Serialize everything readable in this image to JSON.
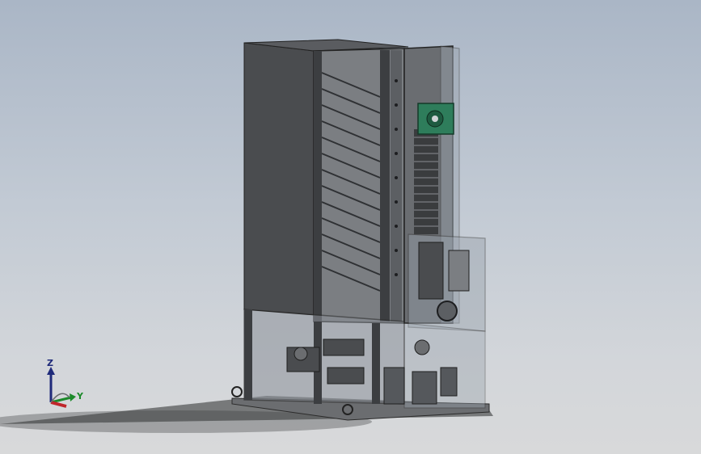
{
  "viewport": {
    "background_top": "#aab6c6",
    "background_bottom": "#d8d9da"
  },
  "model": {
    "frame_color": "#3a3a3a",
    "panel_color": "#4a4c4f",
    "motor_color": "#2e7d5b",
    "glass_color": "#9aa3ad"
  },
  "triad": {
    "z_label": "Z",
    "y_label": "Y",
    "z_color": "#1f2a7a",
    "y_color": "#1c8a2a",
    "x_color": "#c0262b"
  }
}
